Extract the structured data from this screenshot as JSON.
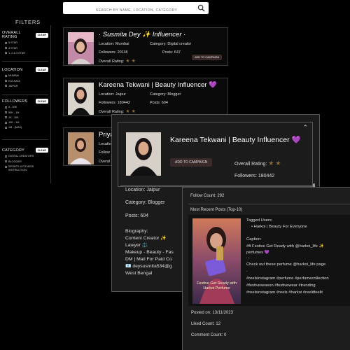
{
  "search": {
    "placeholder": "SEARCH BY NAME, LOCATION, CATEGORY"
  },
  "icons": {
    "search": "search-icon",
    "close": "chevron-up-icon"
  },
  "colors": {
    "accent_purple": "#a070e0",
    "button_dark": "#3a2a2a",
    "star": "#8a6a3a"
  },
  "filters": {
    "title": "FILTERS",
    "clear_label": "CLEAR",
    "groups": [
      {
        "title": "OVERALL RATING",
        "options": [
          "5 STAR",
          "4 STAR",
          "1, 2 & 3 STAR"
        ]
      },
      {
        "title": "LOCATION",
        "options": [
          "MUMBAI",
          "KOLKATA",
          "JAIPUR"
        ]
      },
      {
        "title": "FOLLOWERS",
        "options": [
          "0 - 50K",
          "50K - 1M",
          "1K - 10K",
          "10K - 1M",
          "1M - (MAX)"
        ]
      },
      {
        "title": "CATEGORY",
        "options": [
          "DIGITAL CREATORS",
          "BLOGGER",
          "SPORTS & FITNESS INSTRUCTION"
        ]
      }
    ]
  },
  "cards": [
    {
      "name": "· Susmita Dey ✨ Influencer ·",
      "location": "Location: Mumbai",
      "category": "Category: Digital creator",
      "followers": "Followers: 20118",
      "posts": "Posts: 647",
      "rating_label": "Overall Rating:",
      "rating": 2,
      "add_label": "ADD TO CAMPAIGN"
    },
    {
      "name": "Kareena Tekwani | Beauty Influencer 💜",
      "location": "Location: Jaipur",
      "category": "Category: Blogger",
      "followers": "Followers: 180442",
      "posts": "Posts: 604",
      "rating_label": "Overall Rating:",
      "rating": 2,
      "add_label": "ADD TO CAMPAIGN"
    },
    {
      "name": "Priya",
      "location": "Location",
      "category": "",
      "followers": "Follow",
      "posts": "",
      "rating_label": "Overal",
      "rating": 0,
      "add_label": ""
    }
  ],
  "modal": {
    "name": "Kareena Tekwani | Beauty Influencer 💜",
    "add_label": "ADD TO CAMPAIGN",
    "rating_label": "Overall Rating:",
    "rating": 2,
    "followers": "Followers: 180442",
    "location": "Location: Jaipur",
    "category": "Category: Blogger",
    "posts": "Posts: 604",
    "bio": [
      "Biography:",
      "Content Creator ✨",
      "Lawyer ⚖️",
      "Makeup - Beauty - Fas",
      "DM | Mail For Paid Co",
      "📧 deysusmita534@g",
      "West Bengal"
    ]
  },
  "posts_panel": {
    "follow_count": "Follow Count: 292",
    "recent_title": "Most Recent Posts (Top-10)",
    "tagged_users_label": "Tagged Users:",
    "tagged_users": [
      "Harkoi | Beauty For Everyone"
    ],
    "caption_label": "Caption:",
    "caption_lines": [
      "#ft Festive Get Ready with @harkoi_life ✨",
      "perfumes 💜",
      "...",
      "Check out these perfume @harkoi_life page",
      ".",
      "#reelsinstagram #perfume #perfumecollection",
      "#festiveseason #festivewear #trending",
      "#reelsinstagram #reels #harkoi #reelitfeelit"
    ],
    "posted_on": "Posted on: 13/11/2023",
    "liked_count": "Liked Count: 12",
    "comment_count": "Comment Count: 0",
    "image_text": "Festive Get Ready with Harkoi Perfume"
  }
}
